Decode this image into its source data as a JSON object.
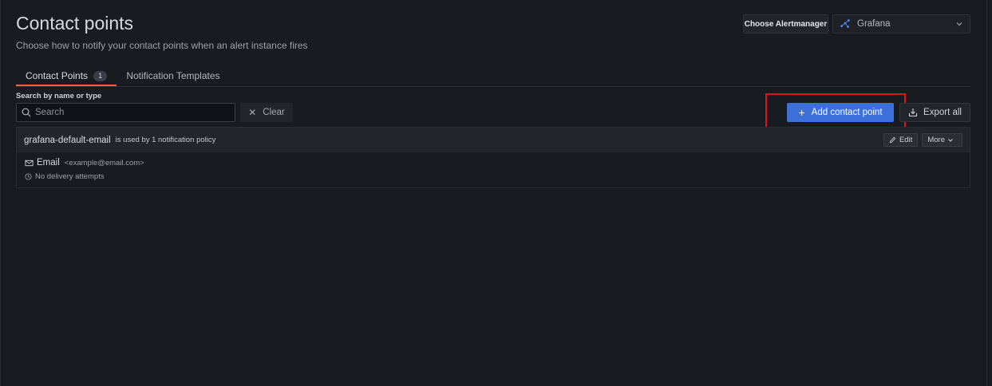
{
  "header": {
    "title": "Contact points",
    "subtitle": "Choose how to notify your contact points when an alert instance fires"
  },
  "alertmanager": {
    "label": "Choose Alertmanager",
    "selected": "Grafana",
    "icon": "grafana-network-icon"
  },
  "tabs": [
    {
      "label": "Contact Points",
      "count": "1",
      "active": true
    },
    {
      "label": "Notification Templates",
      "active": false
    }
  ],
  "search": {
    "label": "Search by name or type",
    "placeholder": "Search",
    "value": "",
    "clear_label": "Clear"
  },
  "actions": {
    "add_label": "Add contact point",
    "export_label": "Export all"
  },
  "contact_points": [
    {
      "name": "grafana-default-email",
      "usage": "is used by 1 notification policy",
      "edit_label": "Edit",
      "more_label": "More",
      "integration": {
        "type": "Email",
        "address": "<example@email.com>",
        "status": "No delivery attempts"
      }
    }
  ],
  "colors": {
    "background": "#181b1f",
    "primary": "#3d71d9",
    "active_tab": "#f55f3e",
    "highlight": "#e0141e"
  }
}
